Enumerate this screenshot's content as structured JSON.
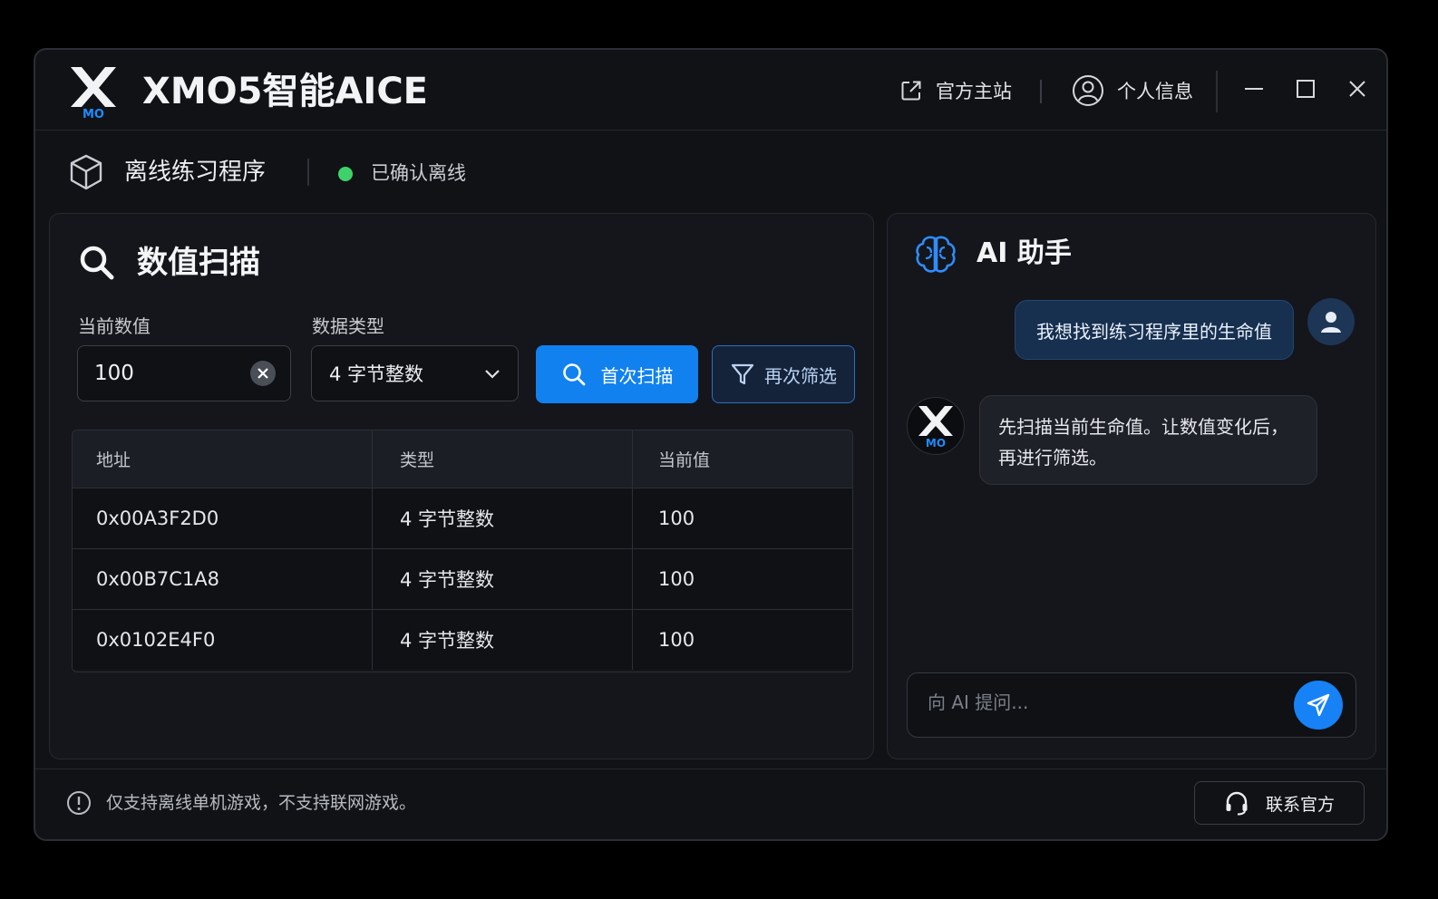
{
  "app": {
    "title": "XMO5智能AICE",
    "logo_sub": "MO",
    "official_site_label": "官方主站",
    "profile_label": "个人信息"
  },
  "program": {
    "name": "离线练习程序",
    "status": "已确认离线",
    "status_color": "#3ed36a"
  },
  "scan": {
    "title": "数值扫描",
    "current_value_label": "当前数值",
    "current_value": "100",
    "data_type_label": "数据类型",
    "data_type_selected": "4 字节整数",
    "first_scan_label": "首次扫描",
    "next_scan_label": "再次筛选",
    "table": {
      "headers": [
        "地址",
        "类型",
        "当前值"
      ],
      "rows": [
        [
          "0x00A3F2D0",
          "4 字节整数",
          "100"
        ],
        [
          "0x00B7C1A8",
          "4 字节整数",
          "100"
        ],
        [
          "0x0102E4F0",
          "4 字节整数",
          "100"
        ]
      ]
    }
  },
  "assistant": {
    "title": "AI 助手",
    "user_message": "我想找到练习程序里的生命值",
    "bot_message": "先扫描当前生命值。让数值变化后，\n再进行筛选。",
    "bot_avatar_sub": "MO",
    "input_placeholder": "向 AI 提问..."
  },
  "footer": {
    "notice": "仅支持离线单机游戏，不支持联网游戏。",
    "contact_label": "联系官方"
  },
  "colors": {
    "accent": "#1181f0",
    "background": "#101216",
    "panel": "#14161b"
  }
}
